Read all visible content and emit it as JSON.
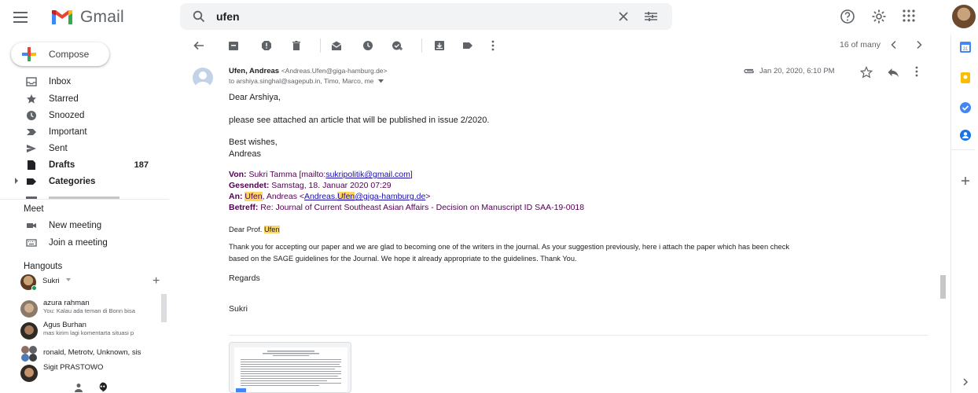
{
  "app": {
    "name": "Gmail"
  },
  "search": {
    "query": "ufen"
  },
  "compose": {
    "label": "Compose"
  },
  "nav": {
    "inbox": "Inbox",
    "starred": "Starred",
    "snoozed": "Snoozed",
    "important": "Important",
    "sent": "Sent",
    "drafts": "Drafts",
    "drafts_count": "187",
    "categories": "Categories"
  },
  "meet": {
    "title": "Meet",
    "new_meeting": "New meeting",
    "join_meeting": "Join a meeting"
  },
  "hangouts": {
    "title": "Hangouts",
    "me": "Sukri",
    "conversations": [
      {
        "name": "azura rahman",
        "message": "You: Kalau ada teman di Bonn bisa"
      },
      {
        "name": "Agus Burhan",
        "message": "mas kirim lagi komentarta situasi p"
      },
      {
        "name": "ronald, Metrotv, Unknown, sis",
        "message": ""
      },
      {
        "name": "Sigit PRASTOWO",
        "message": ""
      }
    ]
  },
  "toolbar": {
    "pager": "16 of many"
  },
  "email": {
    "sender_name": "Ufen, Andreas",
    "sender_email": "<Andreas.Ufen@giga-hamburg.de>",
    "recipients": "to arshiya.singhal@sagepub.in, Timo, Marco, me",
    "date": "Jan 20, 2020, 6:10 PM",
    "greeting": "Dear Arshiya,",
    "line1": "please see attached an article that will be published in issue 2/2020.",
    "closing": "Best wishes,",
    "signature": "Andreas",
    "fwd": {
      "von_label": "Von:",
      "von_value_pre": "Sukri Tamma [mailto:",
      "von_email": "sukripolitik@gmail.com",
      "von_value_post": "]",
      "gesendet_label": "Gesendet:",
      "gesendet_value": "Samstag, 18. Januar 2020 07:29",
      "an_label": "An:",
      "an_name_hl": "Ufen",
      "an_name_rest": ", Andreas <",
      "an_email_1": "Andreas.",
      "an_email_hl": "Ufen",
      "an_email_2": "@giga-hamburg.de",
      "an_end": ">",
      "betreff_label": "Betreff:",
      "betreff_value": "Re: Journal of Current Southeast Asian Affairs - Decision on Manuscript ID SAA-19-0018"
    },
    "quoted": {
      "greeting_pre": "Dear Prof. ",
      "greeting_hl": "Ufen",
      "para_line1": "Thank you for accepting our paper and we are glad to becoming one of the writers in the journal. As your suggestion previously, here i attach the paper which has been check",
      "para_line2": "based on the SAGE guidelines for the Journal. We hope it already appropriate to the guidelines. Thank You.",
      "regards": "Regards",
      "name": "Sukri"
    }
  }
}
